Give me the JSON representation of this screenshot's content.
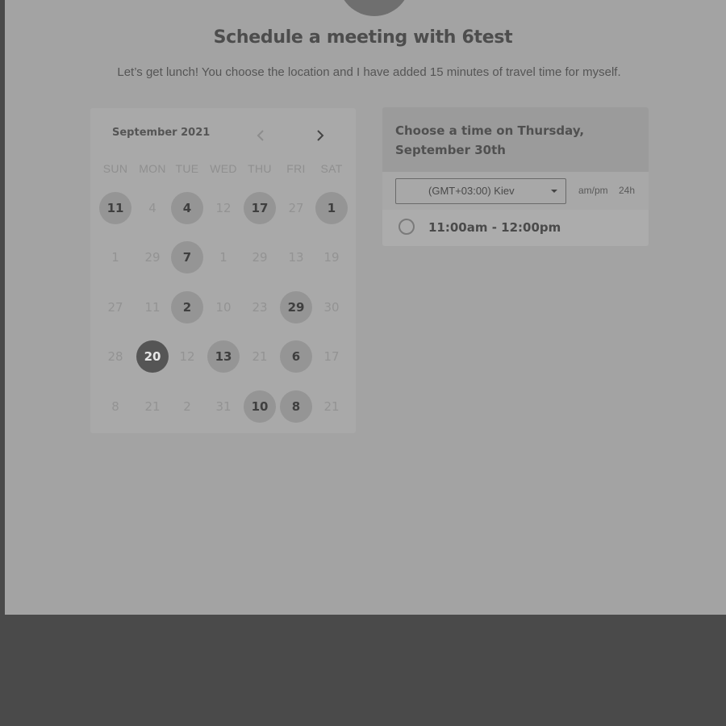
{
  "header": {
    "title": "Schedule a meeting with 6test",
    "subtitle": "Let’s get lunch! You choose the location and I have added 15 minutes of travel time for myself."
  },
  "calendar": {
    "month_label": "September 2021",
    "weekdays": [
      "SUN",
      "MON",
      "TUE",
      "WED",
      "THU",
      "FRI",
      "SAT"
    ],
    "weeks": [
      [
        {
          "d": "11",
          "s": "avail"
        },
        {
          "d": "4",
          "s": "muted"
        },
        {
          "d": "4",
          "s": "avail"
        },
        {
          "d": "12",
          "s": "muted"
        },
        {
          "d": "17",
          "s": "avail"
        },
        {
          "d": "27",
          "s": "muted"
        },
        {
          "d": "1",
          "s": "avail"
        }
      ],
      [
        {
          "d": "1",
          "s": "muted"
        },
        {
          "d": "29",
          "s": "muted"
        },
        {
          "d": "7",
          "s": "avail"
        },
        {
          "d": "1",
          "s": "muted"
        },
        {
          "d": "29",
          "s": "muted"
        },
        {
          "d": "13",
          "s": "muted"
        },
        {
          "d": "19",
          "s": "muted"
        }
      ],
      [
        {
          "d": "27",
          "s": "muted"
        },
        {
          "d": "11",
          "s": "muted"
        },
        {
          "d": "2",
          "s": "avail"
        },
        {
          "d": "10",
          "s": "muted"
        },
        {
          "d": "23",
          "s": "muted"
        },
        {
          "d": "29",
          "s": "avail"
        },
        {
          "d": "30",
          "s": "muted"
        }
      ],
      [
        {
          "d": "28",
          "s": "muted"
        },
        {
          "d": "20",
          "s": "selected"
        },
        {
          "d": "12",
          "s": "muted"
        },
        {
          "d": "13",
          "s": "avail"
        },
        {
          "d": "21",
          "s": "muted"
        },
        {
          "d": "6",
          "s": "avail"
        },
        {
          "d": "17",
          "s": "muted"
        }
      ],
      [
        {
          "d": "8",
          "s": "muted"
        },
        {
          "d": "21",
          "s": "muted"
        },
        {
          "d": "2",
          "s": "muted"
        },
        {
          "d": "31",
          "s": "muted"
        },
        {
          "d": "10",
          "s": "avail"
        },
        {
          "d": "8",
          "s": "avail"
        },
        {
          "d": "21",
          "s": "muted"
        }
      ]
    ]
  },
  "time_panel": {
    "heading": "Choose a time on Thursday, September 30th",
    "timezone": "(GMT+03:00) Kiev",
    "format_ampm": "am/pm",
    "format_24h": "24h",
    "slot": "11:00am - 12:00pm"
  },
  "icons": {
    "prev": "chevron-left-icon",
    "next": "chevron-right-icon",
    "dropdown": "caret-down-icon"
  },
  "colors": {
    "background": "#a3a3a3",
    "selected_day": "#555555",
    "available_day": "#959595"
  }
}
